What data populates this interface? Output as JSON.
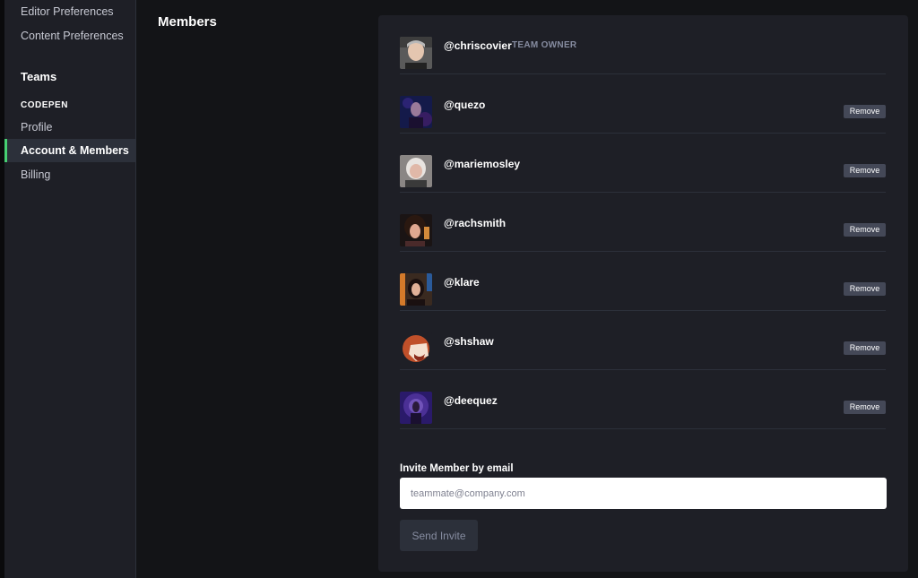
{
  "sidebar": {
    "items_top": [
      {
        "label": "Editor Preferences"
      },
      {
        "label": "Content Preferences"
      }
    ],
    "teams_heading": "Teams",
    "team_group_label": "CODEPEN",
    "team_items": [
      {
        "label": "Profile",
        "active": false
      },
      {
        "label": "Account & Members",
        "active": true
      },
      {
        "label": "Billing",
        "active": false
      }
    ]
  },
  "main": {
    "title": "Members"
  },
  "members": {
    "role_owner": "TEAM OWNER",
    "remove_label": "Remove",
    "list": [
      {
        "handle": "@chriscovier",
        "role": "TEAM OWNER",
        "avatar": "avatar-chriscovier"
      },
      {
        "handle": "@quezo",
        "avatar": "avatar-quezo"
      },
      {
        "handle": "@mariemosley",
        "avatar": "avatar-mariemosley"
      },
      {
        "handle": "@rachsmith",
        "avatar": "avatar-rachsmith"
      },
      {
        "handle": "@klare",
        "avatar": "avatar-klare"
      },
      {
        "handle": "@shshaw",
        "avatar": "avatar-shshaw"
      },
      {
        "handle": "@deequez",
        "avatar": "avatar-deequez"
      }
    ]
  },
  "invite": {
    "label": "Invite Member by email",
    "placeholder": "teammate@company.com",
    "value": "",
    "button_label": "Send Invite"
  },
  "colors": {
    "background": "#131417",
    "panel": "#1e1f26",
    "accent": "#47cf73",
    "button": "#444857"
  }
}
